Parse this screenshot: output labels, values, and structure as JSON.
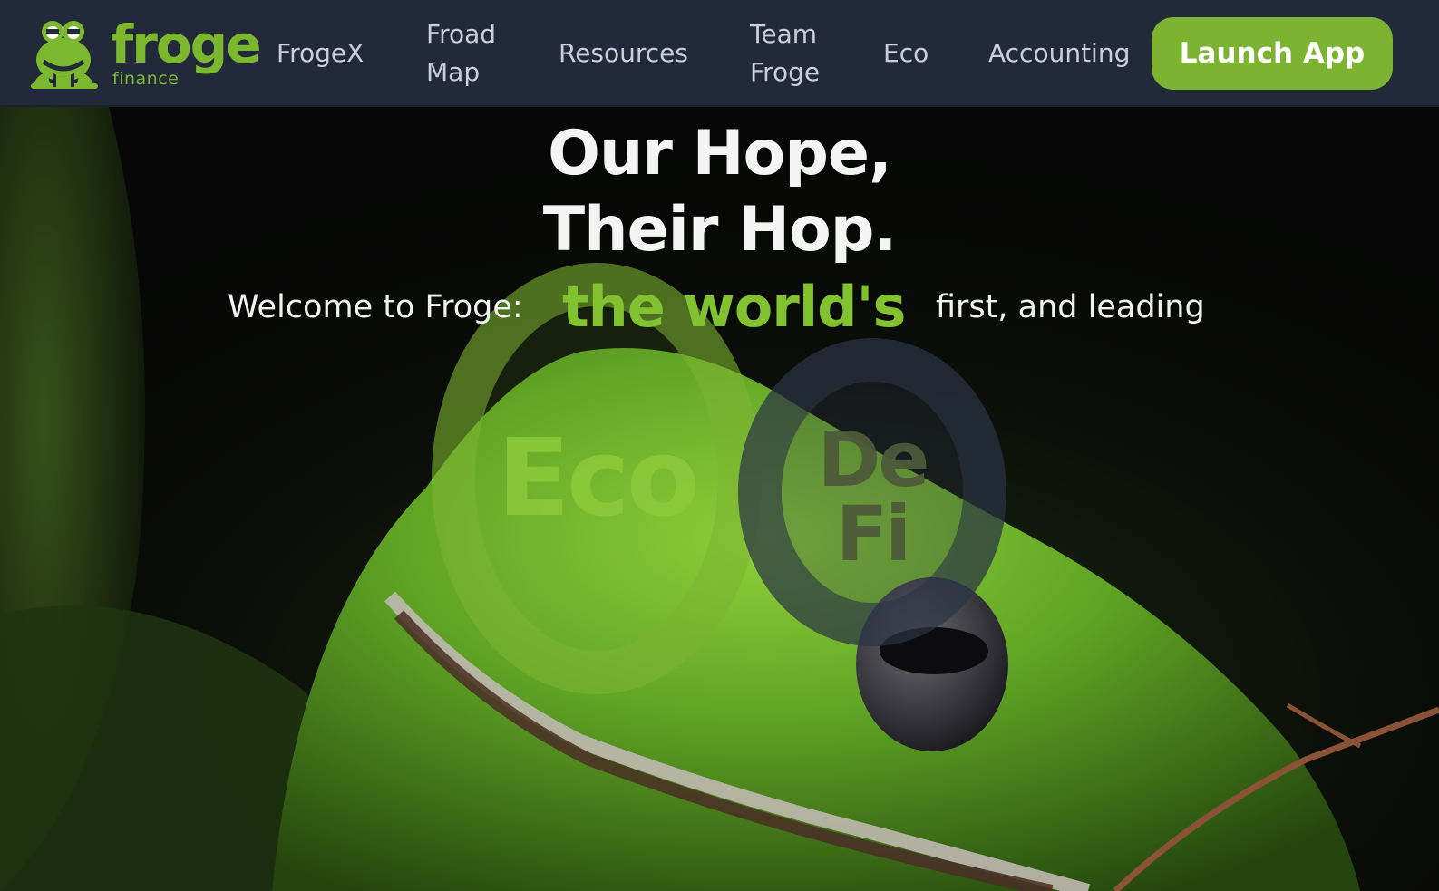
{
  "brand": {
    "name": "froge",
    "subtitle": "finance",
    "accent_color": "#7cb82f",
    "logo_icon": "frog-logo-icon"
  },
  "nav": {
    "items": [
      {
        "label": "FrogeX"
      },
      {
        "label": "Froad Map"
      },
      {
        "label": "Resources"
      },
      {
        "label": "Team Froge"
      },
      {
        "label": "Eco"
      },
      {
        "label": "Accounting"
      }
    ],
    "launch_label": "Launch App",
    "background": "#222a3a"
  },
  "hero": {
    "headline_line1": "Our Hope,",
    "headline_line2": "Their Hop.",
    "welcome_prefix": "Welcome to Froge:",
    "highlight": "the world's",
    "welcome_suffix": "first, and leading",
    "bubble_eco": "Eco",
    "bubble_defi_line1": "De",
    "bubble_defi_line2": "Fi",
    "background_image": "green-frog-photo"
  }
}
